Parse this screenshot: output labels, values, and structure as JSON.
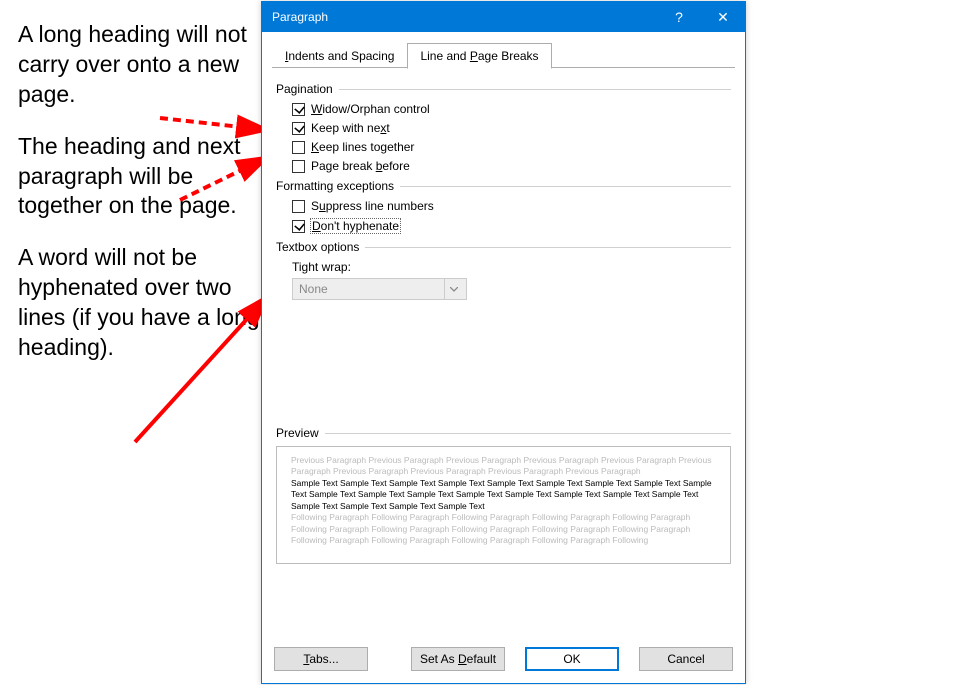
{
  "annotations": {
    "a1": "A long heading will not carry over onto a new page.",
    "a2": "The heading and next paragraph will be together on the page.",
    "a3": "A word will not be hyphenated over two lines (if you have a long heading)."
  },
  "dialog": {
    "title": "Paragraph",
    "help_symbol": "?",
    "close_symbol": "✕",
    "tabs": {
      "indents": {
        "pre": "",
        "acc": "I",
        "post": "ndents and Spacing"
      },
      "breaks": {
        "pre": "Line and ",
        "acc": "P",
        "post": "age Breaks"
      }
    },
    "groups": {
      "pagination": "Pagination",
      "formatting": "Formatting exceptions",
      "textbox": "Textbox options",
      "preview": "Preview"
    },
    "options": {
      "widow": {
        "checked": true,
        "pre": "",
        "acc": "W",
        "post": "idow/Orphan control"
      },
      "keepnext": {
        "checked": true,
        "pre": "Keep with ne",
        "acc": "x",
        "post": "t"
      },
      "keeplines": {
        "checked": false,
        "pre": "",
        "acc": "K",
        "post": "eep lines together"
      },
      "pagebreak": {
        "checked": false,
        "pre": "Page break ",
        "acc": "b",
        "post": "efore"
      },
      "suppress": {
        "checked": false,
        "pre": "S",
        "acc": "u",
        "post": "ppress line numbers"
      },
      "hyphen": {
        "checked": true,
        "pre": "",
        "acc": "D",
        "post": "on't hyphenate",
        "focused": true
      }
    },
    "tightwrap": {
      "label": "Tight wrap:",
      "value": "None",
      "enabled": false
    },
    "preview": {
      "prev": "Previous Paragraph Previous Paragraph Previous Paragraph Previous Paragraph Previous Paragraph Previous Paragraph Previous Paragraph Previous Paragraph Previous Paragraph Previous Paragraph",
      "sample": "Sample Text Sample Text Sample Text Sample Text Sample Text Sample Text Sample Text Sample Text Sample Text Sample Text Sample Text Sample Text Sample Text Sample Text Sample Text Sample Text Sample Text Sample Text Sample Text Sample Text Sample Text",
      "next": "Following Paragraph Following Paragraph Following Paragraph Following Paragraph Following Paragraph Following Paragraph Following Paragraph Following Paragraph Following Paragraph Following Paragraph Following Paragraph Following Paragraph Following Paragraph Following Paragraph Following"
    },
    "buttons": {
      "tabs": {
        "pre": "",
        "acc": "T",
        "post": "abs..."
      },
      "default": {
        "pre": "Set As ",
        "acc": "D",
        "post": "efault"
      },
      "ok": "OK",
      "cancel": "Cancel"
    }
  }
}
